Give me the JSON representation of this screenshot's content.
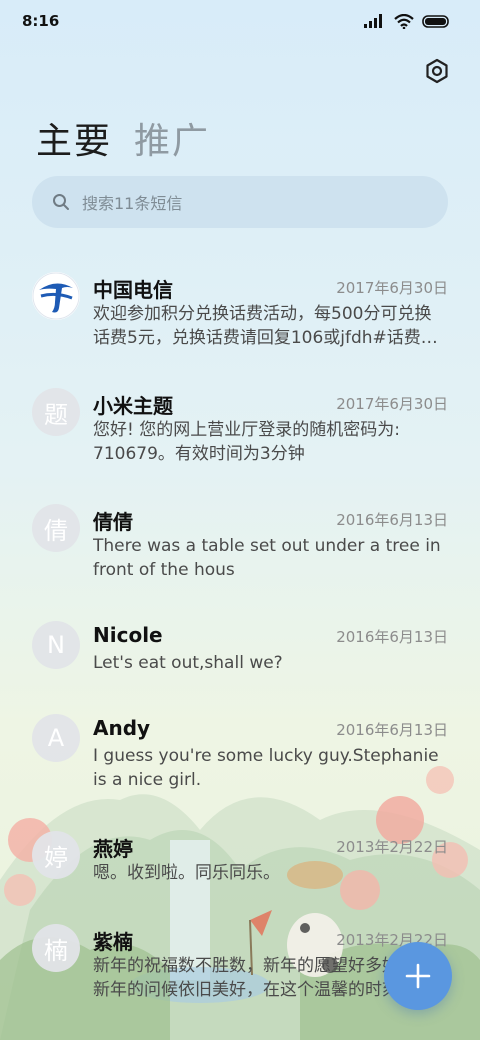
{
  "status_bar": {
    "time": "8:16"
  },
  "header": {
    "tabs": [
      {
        "label": "主要"
      },
      {
        "label": "推广"
      }
    ]
  },
  "search": {
    "placeholder": "搜索11条短信"
  },
  "messages": [
    {
      "sender": "中国电信",
      "date": "2017年6月30日",
      "preview": "欢迎参加积分兑换话费活动，每500分可兑换话费5元，兑换话费请回复106或jfdh#话费…",
      "avatar": "telecom-logo"
    },
    {
      "sender": "小米主题",
      "date": "2017年6月30日",
      "preview": "您好! 您的网上营业厅登录的随机密码为: 710679。有效时间为3分钟",
      "avatar": "题"
    },
    {
      "sender": "倩倩",
      "date": "2016年6月13日",
      "preview": "There was a table set out under a tree in front of the hous",
      "avatar": "倩"
    },
    {
      "sender": "Nicole",
      "date": "2016年6月13日",
      "preview": "Let's eat out,shall we?",
      "avatar": "N"
    },
    {
      "sender": "Andy",
      "date": "2016年6月13日",
      "preview": "I guess you're some lucky guy.Stephanie is a nice girl.",
      "avatar": "A"
    },
    {
      "sender": "燕婷",
      "date": "2013年2月22日",
      "preview": "嗯。收到啦。同乐同乐。",
      "avatar": "婷"
    },
    {
      "sender": "紫楠",
      "date": "2013年2月22日",
      "preview": "新年的祝福数不胜数，新年的愿望好多好多，新年的问候依旧美好，在这个温馨的时刻",
      "avatar": "楠"
    }
  ],
  "colors": {
    "accent": "#5a97e0",
    "avatar_bg": "#e1e4e8",
    "telecom_blue": "#1e5bb5"
  },
  "icons": {
    "settings": "hexagon-gear-icon",
    "search": "search-icon",
    "compose": "plus-icon"
  }
}
